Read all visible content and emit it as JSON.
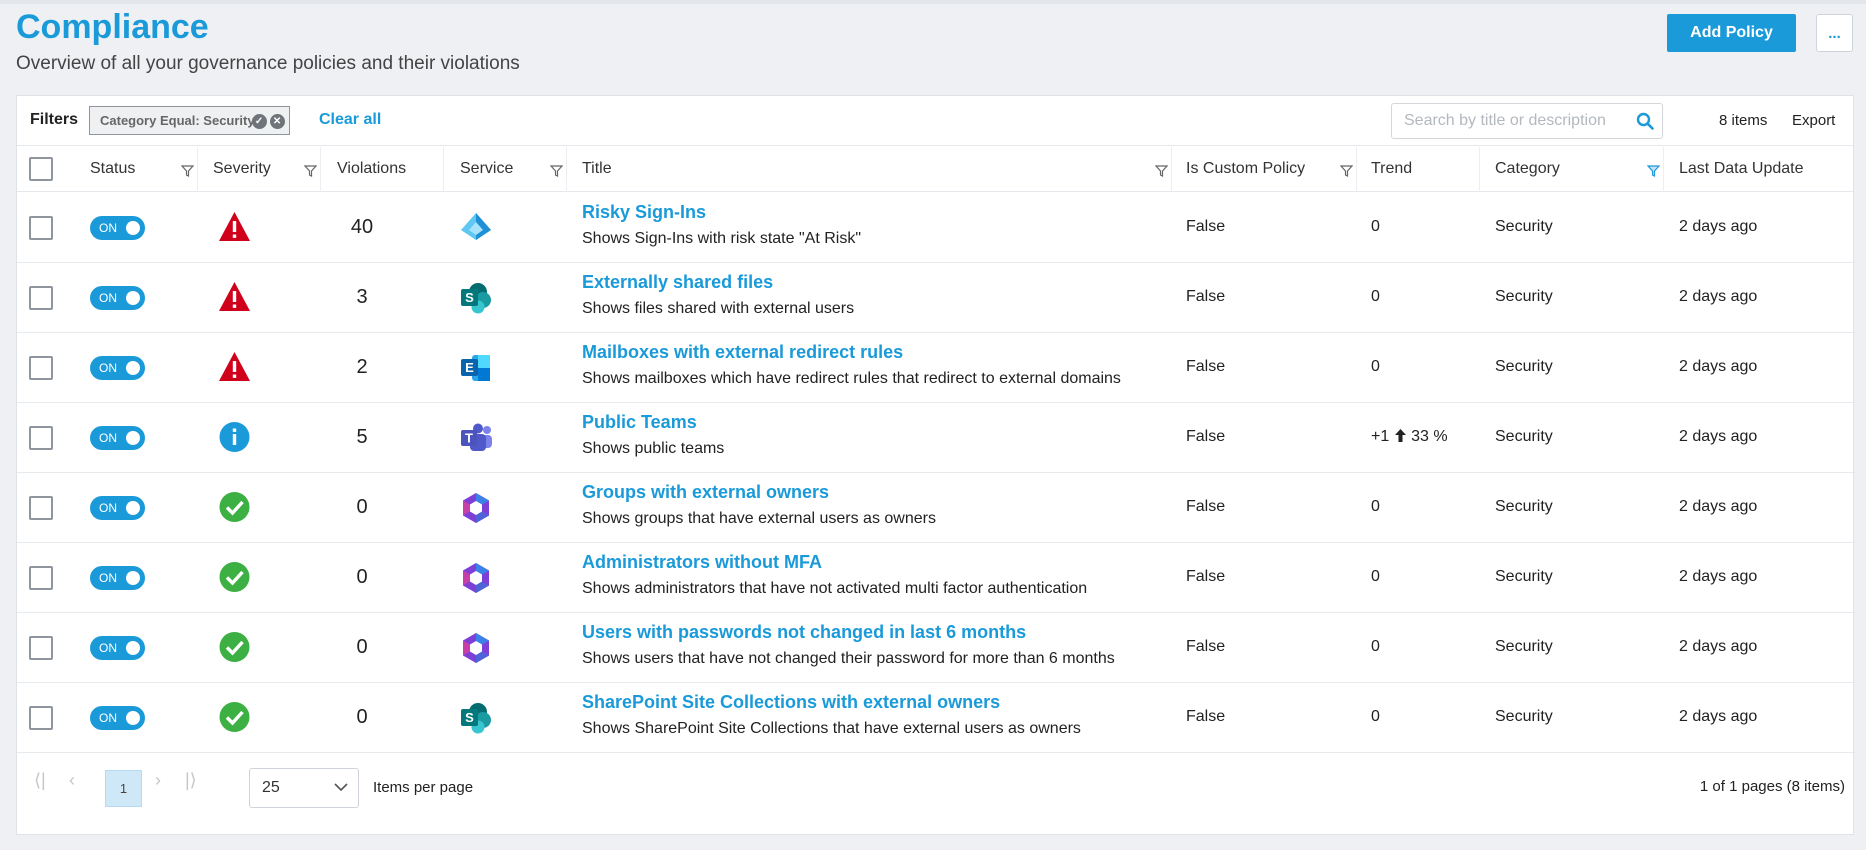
{
  "header": {
    "title": "Compliance",
    "subtitle": "Overview of all your governance policies and their violations",
    "add_button": "Add Policy",
    "more_button": "..."
  },
  "filterbar": {
    "label": "Filters",
    "chip": "Category Equal: Security",
    "clear_all": "Clear all",
    "search_placeholder": "Search by title or description",
    "item_count": "8 items",
    "export": "Export"
  },
  "columns": {
    "status": "Status",
    "severity": "Severity",
    "violations": "Violations",
    "service": "Service",
    "title": "Title",
    "is_custom": "Is Custom Policy",
    "trend": "Trend",
    "category": "Category",
    "last_update": "Last Data Update"
  },
  "rows": [
    {
      "status": "ON",
      "severity": "critical",
      "violations": "40",
      "service": "azure-ad-icon",
      "title": "Risky Sign-Ins",
      "description": "Shows Sign-Ins with risk state \"At Risk\"",
      "is_custom": "False",
      "trend": "0",
      "category": "Security",
      "last_update": "2 days ago"
    },
    {
      "status": "ON",
      "severity": "critical",
      "violations": "3",
      "service": "sharepoint-icon",
      "title": "Externally shared files",
      "description": "Shows files shared with external users",
      "is_custom": "False",
      "trend": "0",
      "category": "Security",
      "last_update": "2 days ago"
    },
    {
      "status": "ON",
      "severity": "critical",
      "violations": "2",
      "service": "exchange-icon",
      "title": "Mailboxes with external redirect rules",
      "description": "Shows mailboxes which have redirect rules that redirect to external domains",
      "is_custom": "False",
      "trend": "0",
      "category": "Security",
      "last_update": "2 days ago"
    },
    {
      "status": "ON",
      "severity": "info",
      "violations": "5",
      "service": "teams-icon",
      "title": "Public Teams",
      "description": "Shows public teams",
      "is_custom": "False",
      "trend": "+1",
      "trend_percent": "33 %",
      "category": "Security",
      "last_update": "2 days ago"
    },
    {
      "status": "ON",
      "severity": "ok",
      "violations": "0",
      "service": "m365-icon",
      "title": "Groups with external owners",
      "description": "Shows groups that have external users as owners",
      "is_custom": "False",
      "trend": "0",
      "category": "Security",
      "last_update": "2 days ago"
    },
    {
      "status": "ON",
      "severity": "ok",
      "violations": "0",
      "service": "m365-icon",
      "title": "Administrators without MFA",
      "description": "Shows administrators that have not activated multi factor authentication",
      "is_custom": "False",
      "trend": "0",
      "category": "Security",
      "last_update": "2 days ago"
    },
    {
      "status": "ON",
      "severity": "ok",
      "violations": "0",
      "service": "m365-icon",
      "title": "Users with passwords not changed in last 6 months",
      "description": "Shows users that have not changed their password for more than 6 months",
      "is_custom": "False",
      "trend": "0",
      "category": "Security",
      "last_update": "2 days ago"
    },
    {
      "status": "ON",
      "severity": "ok",
      "violations": "0",
      "service": "sharepoint-icon",
      "title": "SharePoint Site Collections with external owners",
      "description": "Shows SharePoint Site Collections that have external users as owners",
      "is_custom": "False",
      "trend": "0",
      "category": "Security",
      "last_update": "2 days ago"
    }
  ],
  "pager": {
    "current_page": "1",
    "page_size": "25",
    "items_per_page": "Items per page",
    "page_info": "1 of 1 pages (8 items)"
  },
  "colors": {
    "accent": "#1a9ad9",
    "critical": "#d0021b",
    "ok": "#3cb043",
    "info": "#1a9ad9"
  }
}
